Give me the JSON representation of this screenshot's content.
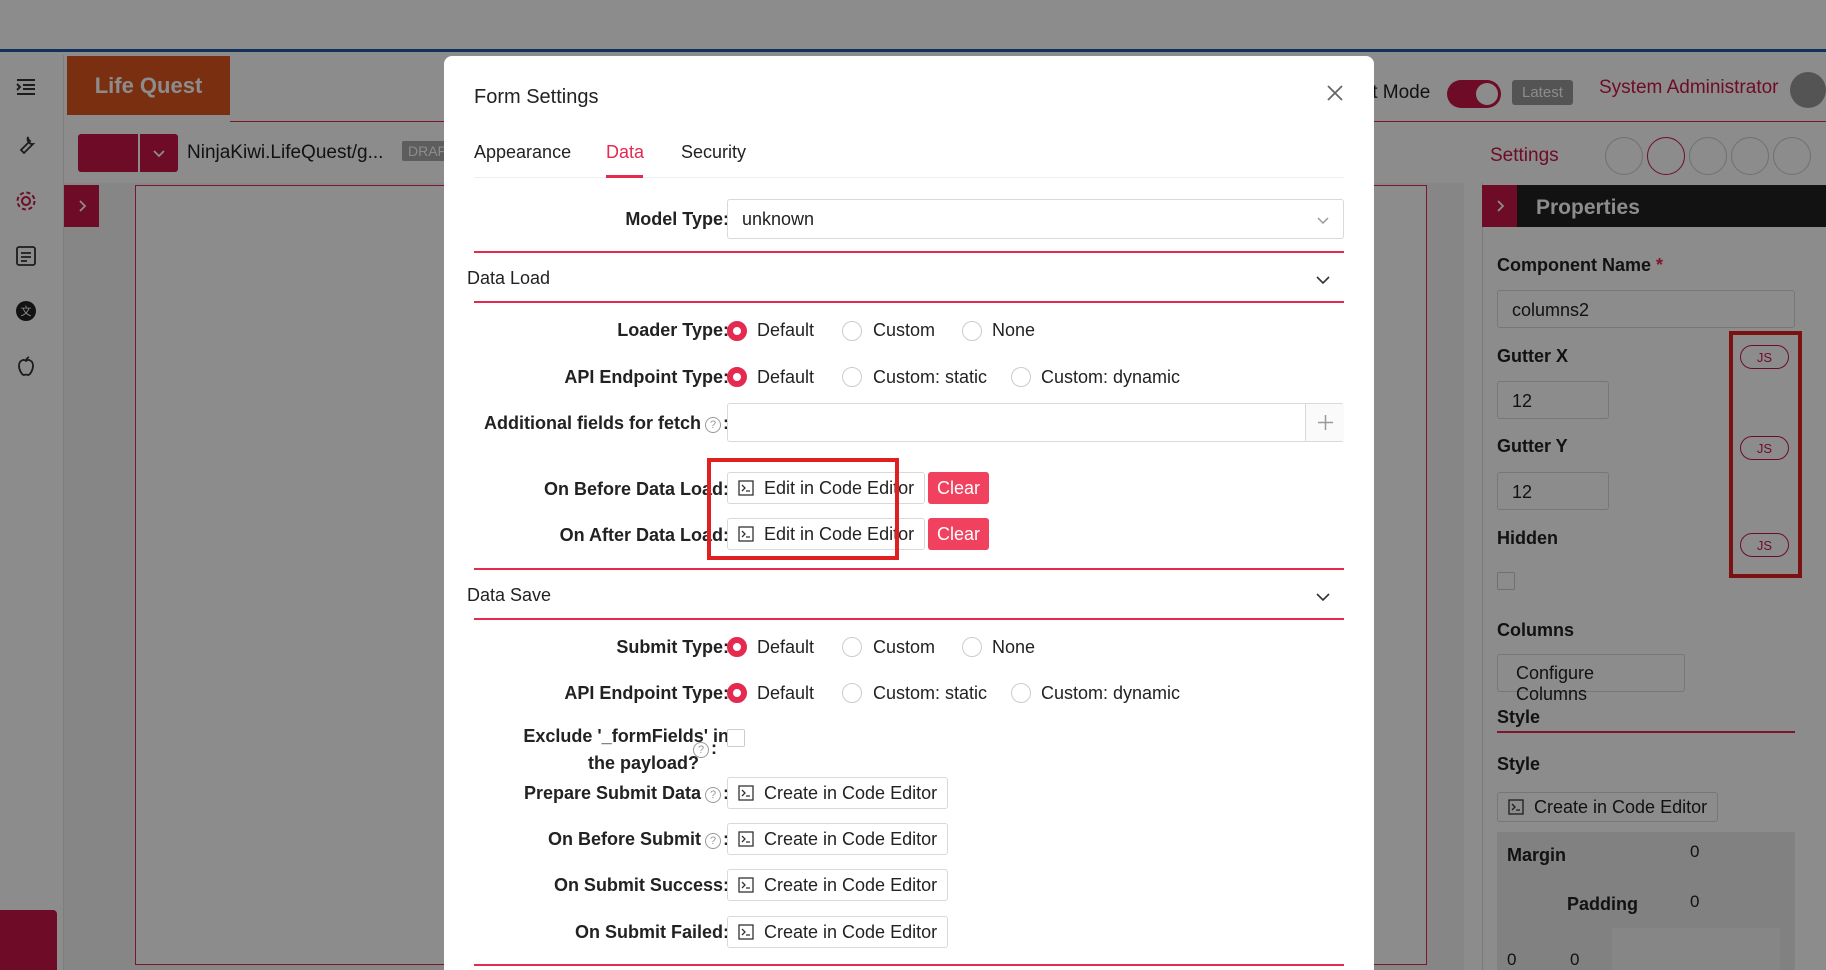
{
  "app": {
    "logo_text": "Life Quest",
    "form_path": "NinjaKiwi.LifeQuest/g...",
    "draft_badge": "DRAF",
    "edit_mode_label": "it Mode",
    "latest_label": "Latest",
    "user_label": "System Administrator",
    "settings_label": "Settings"
  },
  "properties": {
    "title": "Properties",
    "component_name_label": "Component Name",
    "required_mark": "*",
    "component_name_value": "columns2",
    "gutter_x_label": "Gutter X",
    "gutter_x_value": "12",
    "gutter_y_label": "Gutter Y",
    "gutter_y_value": "12",
    "hidden_label": "Hidden",
    "columns_label": "Columns",
    "configure_columns_label": "Configure Columns",
    "style_section_label": "Style",
    "style_label": "Style",
    "create_code_label": "Create in Code Editor",
    "margin_label": "Margin",
    "margin_value": "0",
    "padding_label": "Padding",
    "padding_value": "0",
    "bottom_values": [
      "0",
      "0"
    ],
    "js_label": "JS"
  },
  "modal": {
    "title": "Form Settings",
    "tabs": [
      {
        "label": "Appearance",
        "active": false
      },
      {
        "label": "Data",
        "active": true
      },
      {
        "label": "Security",
        "active": false
      }
    ],
    "model_type_label": "Model Type",
    "model_type_value": "unknown",
    "data_load": {
      "title": "Data Load",
      "loader_type_label": "Loader Type",
      "loader_options": [
        "Default",
        "Custom",
        "None"
      ],
      "api_endpoint_label": "API Endpoint Type",
      "api_options": [
        "Default",
        "Custom: static",
        "Custom: dynamic"
      ],
      "additional_fields_label": "Additional fields for fetch",
      "on_before_label": "On Before Data Load",
      "on_after_label": "On After Data Load",
      "edit_code_label": "Edit in Code Editor",
      "clear_label": "Clear"
    },
    "data_save": {
      "title": "Data Save",
      "submit_type_label": "Submit Type",
      "submit_options": [
        "Default",
        "Custom",
        "None"
      ],
      "api_endpoint_label": "API Endpoint Type",
      "api_options": [
        "Default",
        "Custom: static",
        "Custom: dynamic"
      ],
      "exclude_label_1": "Exclude '_formFields' in",
      "exclude_label_2": "the payload?",
      "prepare_submit_label": "Prepare Submit Data",
      "on_before_submit_label": "On Before Submit",
      "on_submit_success_label": "On Submit Success",
      "on_submit_failed_label": "On Submit Failed",
      "create_code_label": "Create in Code Editor"
    },
    "colon": ":"
  },
  "colors": {
    "accent": "#e5294f",
    "brand": "#c8174a",
    "logo": "#e0561f",
    "highlight": "#e02020"
  }
}
